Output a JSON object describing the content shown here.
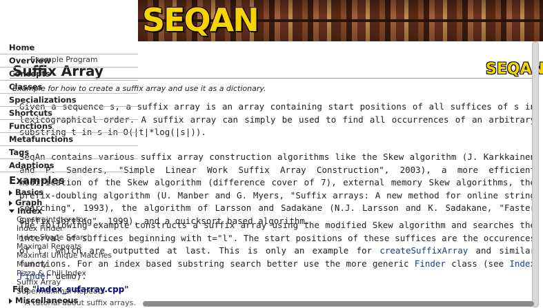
{
  "banner": {
    "logo_text": "SEQAN"
  },
  "content_logo": "SEQAN",
  "nav": {
    "items": [
      {
        "label": "Home"
      },
      {
        "label": "Overview"
      },
      {
        "label": "Concepts"
      },
      {
        "label": "Classes"
      },
      {
        "label": "Specializations"
      },
      {
        "label": "Shortcuts"
      },
      {
        "label": "Functions"
      },
      {
        "label": "Metafunctions"
      },
      {
        "label": "Tags"
      },
      {
        "label": "Adaptions"
      }
    ],
    "overlap_text": "Example Program",
    "examples_heading": "Examples",
    "groups": [
      {
        "label": "Basics"
      },
      {
        "label": "Graph"
      },
      {
        "label": "Index"
      }
    ],
    "index_subitems": [
      "Constraint Iterator",
      "Index Finder",
      "Index Shape Search",
      "Maximal Repeats",
      "Maximal Unique Matches",
      "Mummy",
      "Pizza & Chili Index",
      "Suffix Array",
      "Supermaximal Repeats"
    ],
    "misc_label": "Miscellaneous"
  },
  "main": {
    "title": "Suffix Array",
    "subtitle": "Example for how to create a suffix array and use it as a dictionary.",
    "para1": "Given a sequence s, a suffix array is an array containing start positions of all suffices of s in lexicographical order. A suffix array can simply be used to find all occurrences of an arbitrary substring t in s in O(|t|*log(|s|)).",
    "para2": "SeqAn contains various suffix array construction algorithms like the Skew algorithm (J. Karkkainen and P. Sanders, \"Simple Linear Work Suffix Array Construction\", 2003), a more efficient modification of the Skew algorithm (difference cover of 7), external memory Skew algorithms, the prefix-doubling algorithm (U. Manber and G. Myers, \"Suffix arrays: A new method for online string searching\", 1993), the algorithm of Larsson and Sadakane (N.J. Larsson and K. Sadakane, \"Faster Suffix Sorting\", 1999), and a quicksort based algorithm.",
    "para3_a": "The following example constructs a suffix array using the modified Skew algorithm and searches the interval of suffices beginning with t=\"l\". The start positions of these suffices are the occurences of t, which are outputted at last. This is only an example for ",
    "para3_link1": "createSuffixArray",
    "para3_b": " and similar functions. For an index based substring search better use the more generic ",
    "para3_link2": "Finder",
    "para3_c": " class (see ",
    "para3_link3": "Index Finder",
    "para3_d": " demo).",
    "file_label": "File \"",
    "file_name": "index_sufarray.cpp",
    "file_end": "\"",
    "tutorial_text": "A tutorial about suffix arrays."
  }
}
